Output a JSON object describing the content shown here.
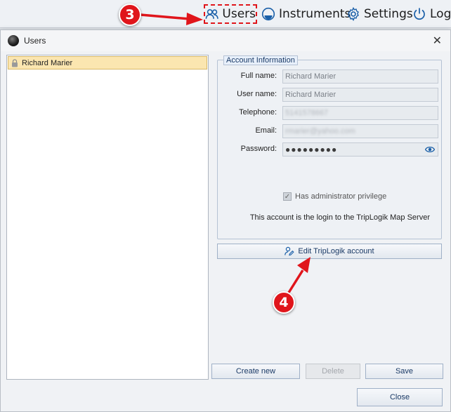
{
  "toolbar": {
    "users_label": "Users",
    "instruments_label": "Instruments",
    "settings_label": "Settings",
    "logout_label": "Logo"
  },
  "callouts": {
    "step3": "3",
    "step4": "4"
  },
  "dialog": {
    "title": "Users",
    "close_glyph": "✕",
    "users": [
      {
        "name": "Richard Marier"
      }
    ],
    "account": {
      "group_title": "Account Information",
      "fullname_label": "Full name:",
      "fullname_value": "Richard Marier",
      "username_label": "User name:",
      "username_value": "Richard Marier",
      "telephone_label": "Telephone:",
      "telephone_value": "5141578667",
      "email_label": "Email:",
      "email_value": "rmarier@yahoo.com",
      "password_label": "Password:",
      "password_value": "●●●●●●●●●",
      "admin_label": "Has administrator privilege",
      "admin_checked": true,
      "login_note": "This account is the login to the TripLogik Map Server"
    },
    "buttons": {
      "edit": "Edit TripLogik account",
      "create": "Create new",
      "delete": "Delete",
      "save": "Save",
      "close": "Close"
    }
  },
  "colors": {
    "callout": "#e0151b",
    "selected_row": "#fbe6b0",
    "accent": "#1a5fa8"
  },
  "icons": [
    "users-icon",
    "instruments-icon",
    "settings-gear-icon",
    "power-icon",
    "lock-icon",
    "eye-icon",
    "user-edit-icon",
    "app-orb-icon"
  ]
}
